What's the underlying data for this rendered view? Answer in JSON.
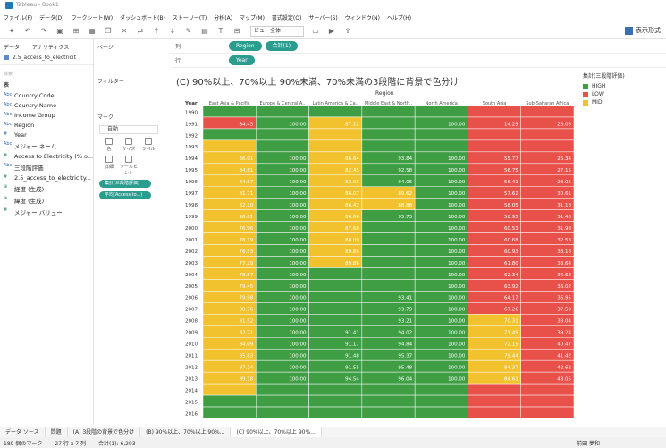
{
  "window": {
    "title": "Tableau - Book1"
  },
  "menu": [
    "ファイル(F)",
    "データ(D)",
    "ワークシート(W)",
    "ダッシュボード(B)",
    "ストーリー(T)",
    "分析(A)",
    "マップ(M)",
    "書式設定(O)",
    "サーバー(S)",
    "ウィンドウ(N)",
    "ヘルプ(H)"
  ],
  "toolbar": {
    "fit_select": "ビュー全体",
    "show_me": "表示形式"
  },
  "left_pane": {
    "tabs": [
      "データ",
      "アナリティクス"
    ],
    "pages_label": "ページ",
    "source": "2.5_access_to_electricit",
    "search": "検索",
    "section_label": "表",
    "fields": [
      {
        "name": "Country Code",
        "kind": "dim",
        "icon": "Abc"
      },
      {
        "name": "Country Name",
        "kind": "dim",
        "icon": "Abc"
      },
      {
        "name": "Income Group",
        "kind": "dim",
        "icon": "Abc"
      },
      {
        "name": "Region",
        "kind": "dim",
        "icon": "Abc"
      },
      {
        "name": "Year",
        "kind": "dim",
        "icon": "#"
      },
      {
        "name": "メジャー ネーム",
        "kind": "dim",
        "icon": "Abc"
      },
      {
        "name": "Access to Electricity (% o...",
        "kind": "meas",
        "icon": "#"
      },
      {
        "name": "三段階評価",
        "kind": "dim",
        "icon": "Abc"
      },
      {
        "name": "2.5_access_to_electricity...",
        "kind": "meas",
        "icon": "#"
      },
      {
        "name": "経度 (生成)",
        "kind": "meas",
        "icon": "⊕"
      },
      {
        "name": "緯度 (生成)",
        "kind": "meas",
        "icon": "⊕"
      },
      {
        "name": "メジャー バリュー",
        "kind": "meas",
        "icon": "#"
      }
    ]
  },
  "mid_pane": {
    "filters_label": "フィルター",
    "marks_label": "マーク",
    "marks_type": "自動",
    "mark_buttons": [
      "色",
      "サイズ",
      "ラベル",
      "詳細",
      "ツールヒント"
    ],
    "pills": [
      "集計(三段階評価)",
      "平均(Access to...)"
    ]
  },
  "shelves": {
    "columns_label": "列",
    "columns_pills": [
      "Region",
      "合計(1)"
    ],
    "rows_label": "行",
    "rows_pills": [
      "Year"
    ]
  },
  "chart": {
    "title": "(C) 90%以上、70%以上 90%未満、70%未満の3段階に背景で色分け",
    "region_header": "Region",
    "year_header": "Year"
  },
  "chart_data": {
    "type": "table",
    "regions": [
      "East Asia & Pacific",
      "Europe & Central A..",
      "Latin America & Ca..",
      "Middle East & North..",
      "North America",
      "South Asia",
      "Sub-Saharan Africa"
    ],
    "years": [
      "1990",
      "1991",
      "1992",
      "1993",
      "1994",
      "1995",
      "1996",
      "1997",
      "1998",
      "1999",
      "2000",
      "2001",
      "2002",
      "2003",
      "2004",
      "2005",
      "2006",
      "2007",
      "2008",
      "2009",
      "2010",
      "2011",
      "2012",
      "2013",
      "2014",
      "2015",
      "2016"
    ],
    "values": {
      "East Asia & Pacific": [
        null,
        84.43,
        null,
        null,
        86.01,
        84.81,
        84.67,
        81.71,
        82.1,
        96.01,
        76.96,
        76.19,
        76.53,
        77.29,
        78.57,
        79.45,
        79.98,
        80.76,
        81.52,
        82.21,
        84.09,
        85.83,
        87.14,
        89.18,
        null,
        null,
        null
      ],
      "Europe & Central A..": [
        null,
        100.0,
        null,
        null,
        100.0,
        100.0,
        100.0,
        100.0,
        100.0,
        100.0,
        100.0,
        100.0,
        100.0,
        100.0,
        100.0,
        100.0,
        100.0,
        100.0,
        100.0,
        100.0,
        100.0,
        100.0,
        100.0,
        100.0,
        null,
        null,
        null
      ],
      "Latin America & Ca..": [
        null,
        87.22,
        null,
        null,
        86.64,
        82.45,
        83.06,
        86.07,
        86.42,
        86.66,
        87.68,
        88.09,
        89.86,
        89.86,
        null,
        null,
        null,
        null,
        null,
        91.41,
        91.17,
        91.48,
        91.55,
        94.54,
        null,
        null,
        null
      ],
      "Middle East & North..": [
        null,
        null,
        null,
        null,
        93.84,
        92.58,
        94.06,
        89.62,
        88.88,
        95.73,
        null,
        null,
        null,
        null,
        null,
        null,
        93.41,
        93.79,
        93.21,
        94.02,
        94.84,
        95.37,
        95.48,
        96.04,
        null,
        null,
        null
      ],
      "North America": [
        null,
        100.0,
        null,
        null,
        100.0,
        100.0,
        100.0,
        100.0,
        100.0,
        100.0,
        100.0,
        100.0,
        100.0,
        100.0,
        100.0,
        100.0,
        100.0,
        100.0,
        100.0,
        100.0,
        100.0,
        100.0,
        100.0,
        100.0,
        null,
        null,
        null
      ],
      "South Asia": [
        null,
        14.29,
        null,
        null,
        55.77,
        56.75,
        56.41,
        57.62,
        58.05,
        58.95,
        60.53,
        60.68,
        60.93,
        61.8,
        62.34,
        63.92,
        64.17,
        67.26,
        70.31,
        71.49,
        72.15,
        79.44,
        84.37,
        84.61,
        null,
        null,
        null
      ],
      "Sub-Saharan Africa": [
        null,
        23.08,
        null,
        null,
        26.34,
        27.15,
        28.05,
        30.61,
        31.18,
        31.43,
        31.98,
        32.53,
        33.18,
        33.64,
        34.68,
        36.02,
        36.95,
        37.59,
        38.04,
        39.24,
        40.47,
        41.42,
        42.62,
        43.05,
        null,
        null,
        null
      ]
    },
    "levels": {
      "East Asia & Pacific": [
        "HIGH",
        "LOW",
        "HIGH",
        "MID",
        "MID",
        "MID",
        "MID",
        "MID",
        "MID",
        "MID",
        "MID",
        "MID",
        "MID",
        "MID",
        "MID",
        "MID",
        "MID",
        "MID",
        "MID",
        "MID",
        "MID",
        "MID",
        "MID",
        "MID",
        "MID",
        "HIGH",
        "HIGH"
      ],
      "Europe & Central A..": [
        "HIGH",
        "HIGH",
        "HIGH",
        "HIGH",
        "HIGH",
        "HIGH",
        "HIGH",
        "HIGH",
        "HIGH",
        "HIGH",
        "HIGH",
        "HIGH",
        "HIGH",
        "HIGH",
        "HIGH",
        "HIGH",
        "HIGH",
        "HIGH",
        "HIGH",
        "HIGH",
        "HIGH",
        "HIGH",
        "HIGH",
        "HIGH",
        "HIGH",
        "HIGH",
        "HIGH"
      ],
      "Latin America & Ca..": [
        "HIGH",
        "MID",
        "MID",
        "MID",
        "MID",
        "MID",
        "MID",
        "MID",
        "MID",
        "MID",
        "MID",
        "MID",
        "MID",
        "MID",
        "HIGH",
        "HIGH",
        "HIGH",
        "HIGH",
        "HIGH",
        "HIGH",
        "HIGH",
        "HIGH",
        "HIGH",
        "HIGH",
        "HIGH",
        "HIGH",
        "HIGH"
      ],
      "Middle East & North..": [
        "HIGH",
        "HIGH",
        "HIGH",
        "HIGH",
        "HIGH",
        "HIGH",
        "HIGH",
        "MID",
        "MID",
        "HIGH",
        "HIGH",
        "HIGH",
        "HIGH",
        "HIGH",
        "HIGH",
        "HIGH",
        "HIGH",
        "HIGH",
        "HIGH",
        "HIGH",
        "HIGH",
        "HIGH",
        "HIGH",
        "HIGH",
        "HIGH",
        "HIGH",
        "HIGH"
      ],
      "North America": [
        "HIGH",
        "HIGH",
        "HIGH",
        "HIGH",
        "HIGH",
        "HIGH",
        "HIGH",
        "HIGH",
        "HIGH",
        "HIGH",
        "HIGH",
        "HIGH",
        "HIGH",
        "HIGH",
        "HIGH",
        "HIGH",
        "HIGH",
        "HIGH",
        "HIGH",
        "HIGH",
        "HIGH",
        "HIGH",
        "HIGH",
        "HIGH",
        "HIGH",
        "HIGH",
        "HIGH"
      ],
      "South Asia": [
        "LOW",
        "LOW",
        "LOW",
        "LOW",
        "LOW",
        "LOW",
        "LOW",
        "LOW",
        "LOW",
        "LOW",
        "LOW",
        "LOW",
        "LOW",
        "LOW",
        "LOW",
        "LOW",
        "LOW",
        "LOW",
        "MID",
        "MID",
        "MID",
        "MID",
        "MID",
        "MID",
        "LOW",
        "LOW",
        "LOW"
      ],
      "Sub-Saharan Africa": [
        "LOW",
        "LOW",
        "LOW",
        "LOW",
        "LOW",
        "LOW",
        "LOW",
        "LOW",
        "LOW",
        "LOW",
        "LOW",
        "LOW",
        "LOW",
        "LOW",
        "LOW",
        "LOW",
        "LOW",
        "LOW",
        "LOW",
        "LOW",
        "LOW",
        "LOW",
        "LOW",
        "LOW",
        "LOW",
        "LOW",
        "LOW"
      ]
    },
    "legend": {
      "title": "集計(三段階評価)",
      "items": [
        "HIGH",
        "LOW",
        "MID"
      ]
    },
    "colors": {
      "HIGH": "#3f9e44",
      "LOW": "#e8504a",
      "MID": "#f2c12e"
    }
  },
  "sheet_tabs": [
    "データ ソース",
    "問題",
    "(A) 3段階の背景で色分け",
    "(B) 90%以上、70%以上 90%...",
    "(C) 90%以上、70%以上 90%..."
  ],
  "status": {
    "marks": "189 個のマーク",
    "rows_cols": "27 行 x 7 列",
    "sum": "合計(1): 6,293",
    "user": "前田 夢和"
  }
}
